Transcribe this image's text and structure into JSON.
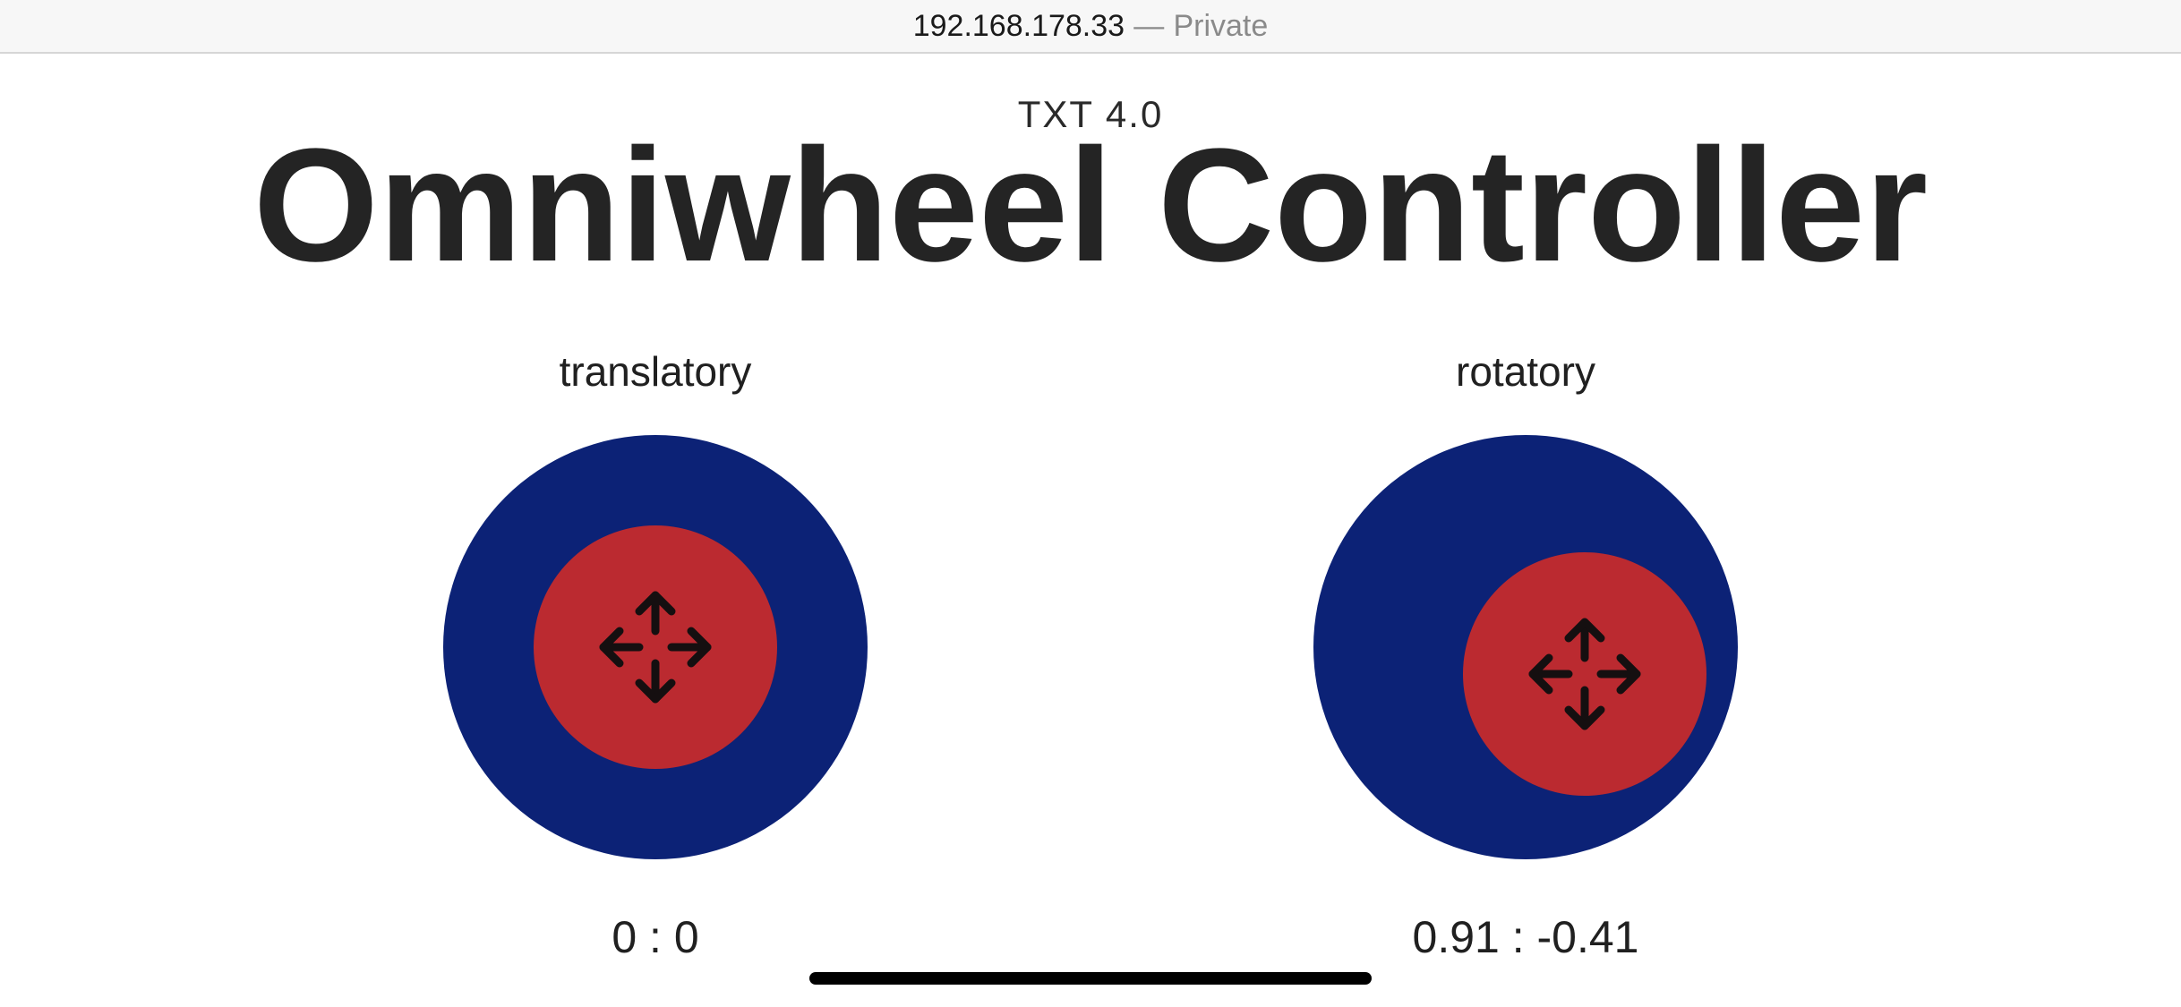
{
  "browser": {
    "host": "192.168.178.33",
    "separator": "—",
    "mode": "Private"
  },
  "header": {
    "subtitle": "TXT 4.0",
    "title": "Omniwheel Controller"
  },
  "joysticks": [
    {
      "label": "translatory",
      "value_text": "0 : 0",
      "x": 0,
      "y": 0,
      "knob_icon": "move-arrows-icon"
    },
    {
      "label": "rotatory",
      "value_text": "0.91 : -0.41",
      "x": 0.91,
      "y": -0.41,
      "knob_icon": "move-arrows-icon"
    }
  ],
  "colors": {
    "joystick_base": "#0c2276",
    "joystick_knob": "#bb2a30",
    "text": "#242424"
  }
}
